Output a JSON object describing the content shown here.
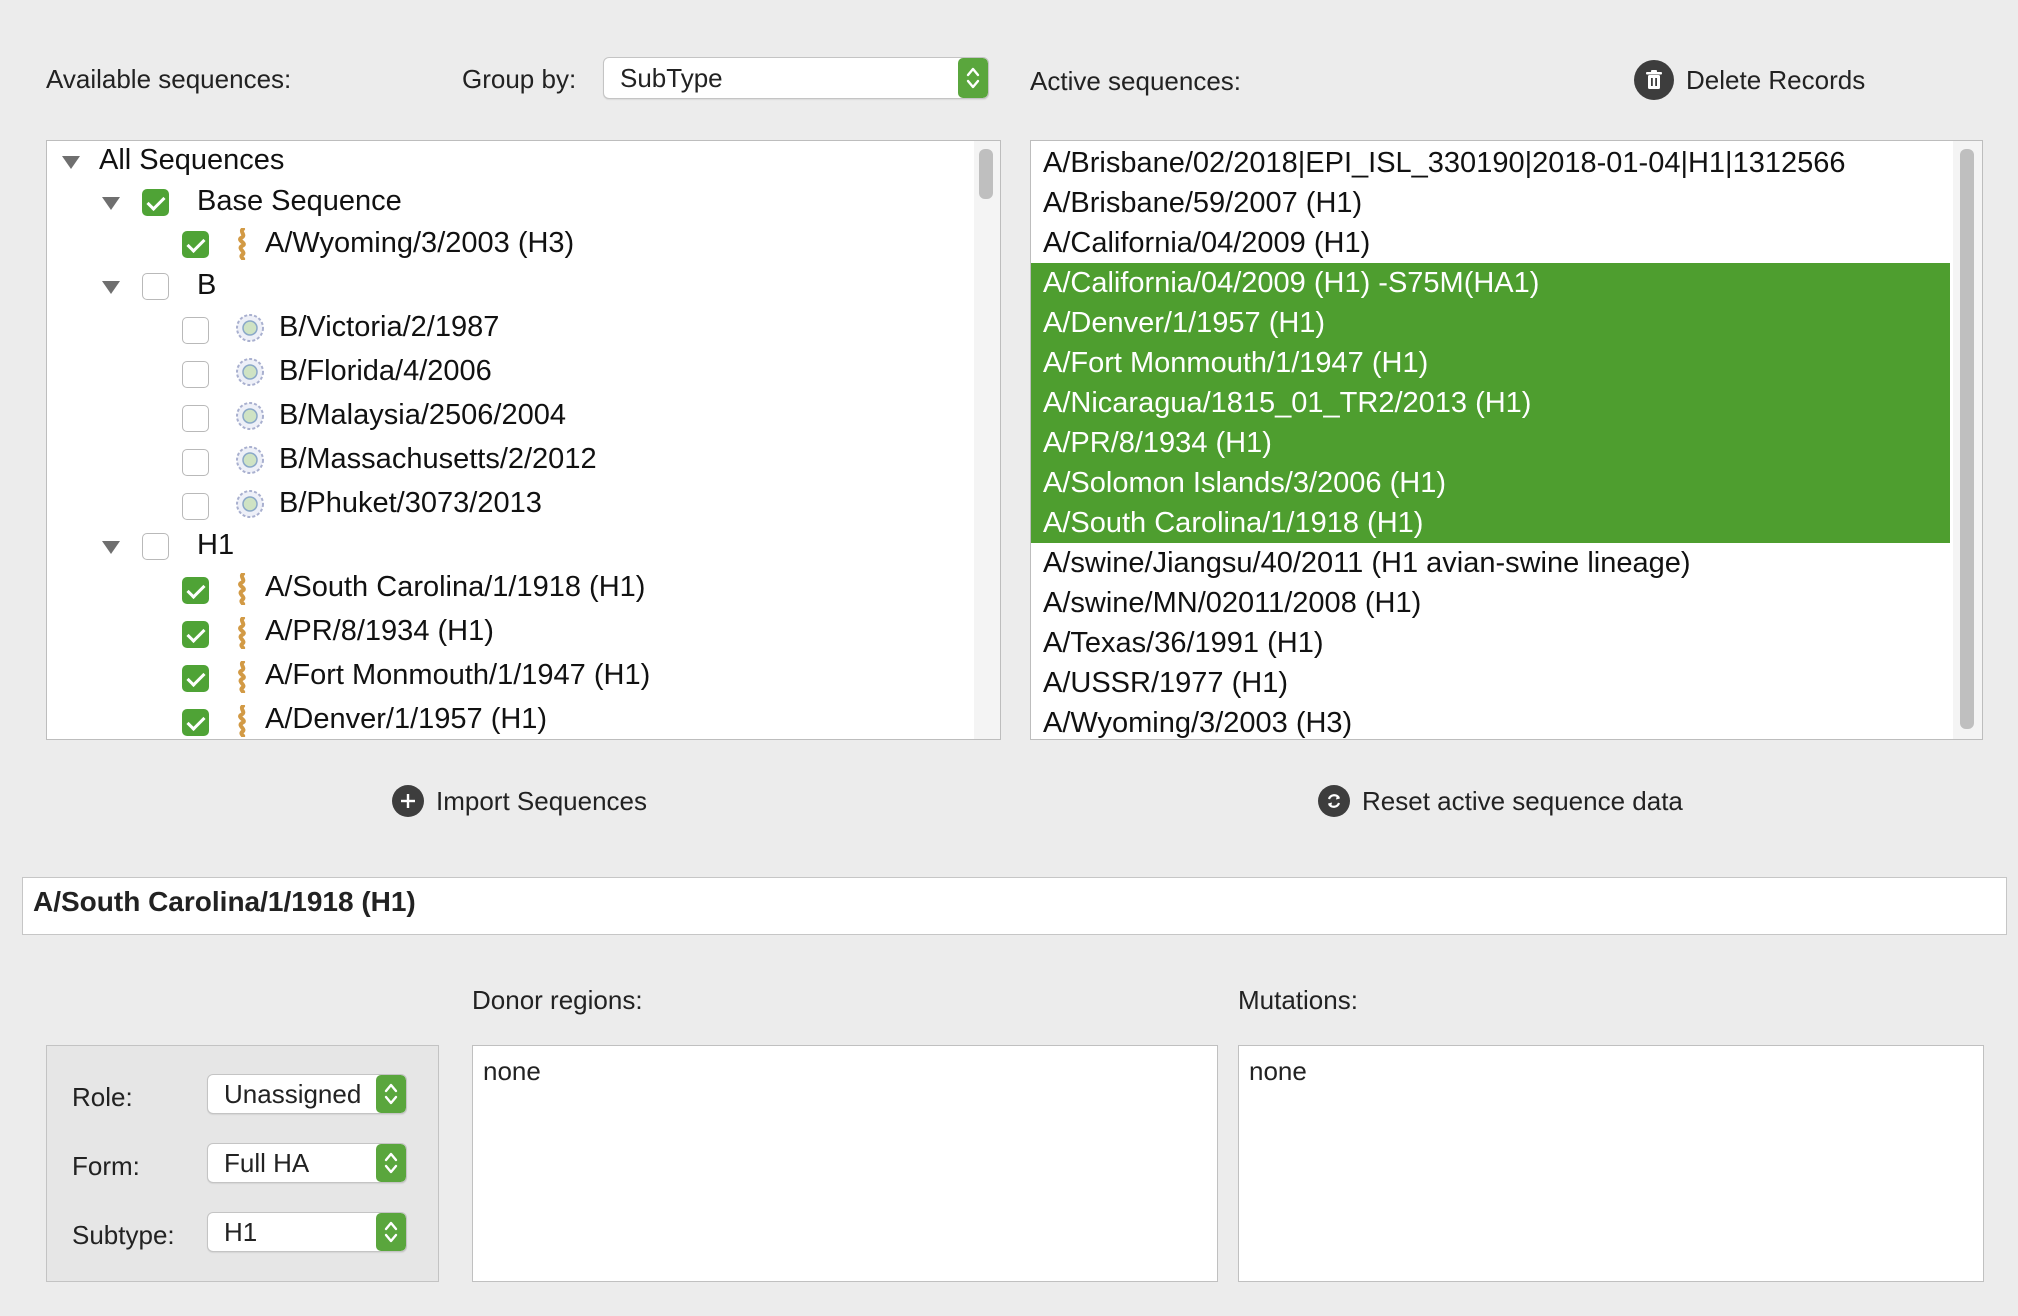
{
  "header": {
    "available_label": "Available sequences:",
    "group_by_label": "Group by:",
    "group_by_value": "SubType",
    "active_label": "Active sequences:",
    "delete_records": "Delete Records"
  },
  "tree": {
    "root": "All Sequences",
    "groups": [
      {
        "label": "Base Sequence",
        "checked": true,
        "items": [
          {
            "label": "A/Wyoming/3/2003 (H3)",
            "checked": true
          }
        ]
      },
      {
        "label": "B",
        "checked": false,
        "items": [
          {
            "label": "B/Victoria/2/1987",
            "checked": false
          },
          {
            "label": "B/Florida/4/2006",
            "checked": false
          },
          {
            "label": "B/Malaysia/2506/2004",
            "checked": false
          },
          {
            "label": "B/Massachusetts/2/2012",
            "checked": false
          },
          {
            "label": "B/Phuket/3073/2013",
            "checked": false
          }
        ]
      },
      {
        "label": "H1",
        "checked": false,
        "items": [
          {
            "label": "A/South Carolina/1/1918 (H1)",
            "checked": true
          },
          {
            "label": "A/PR/8/1934 (H1)",
            "checked": true
          },
          {
            "label": "A/Fort Monmouth/1/1947 (H1)",
            "checked": true
          },
          {
            "label": "A/Denver/1/1957 (H1)",
            "checked": true
          }
        ]
      }
    ]
  },
  "active_sequences": [
    {
      "label": "A/Brisbane/02/2018|EPI_ISL_330190|2018-01-04|H1|1312566",
      "selected": false
    },
    {
      "label": "A/Brisbane/59/2007 (H1)",
      "selected": false
    },
    {
      "label": "A/California/04/2009 (H1)",
      "selected": false
    },
    {
      "label": "A/California/04/2009 (H1) -S75M(HA1)",
      "selected": true
    },
    {
      "label": "A/Denver/1/1957 (H1)",
      "selected": true
    },
    {
      "label": "A/Fort Monmouth/1/1947 (H1)",
      "selected": true
    },
    {
      "label": "A/Nicaragua/1815_01_TR2/2013 (H1)",
      "selected": true
    },
    {
      "label": "A/PR/8/1934 (H1)",
      "selected": true
    },
    {
      "label": "A/Solomon Islands/3/2006 (H1)",
      "selected": true
    },
    {
      "label": "A/South Carolina/1/1918 (H1)",
      "selected": true
    },
    {
      "label": "A/swine/Jiangsu/40/2011 (H1 avian-swine lineage)",
      "selected": false
    },
    {
      "label": "A/swine/MN/02011/2008 (H1)",
      "selected": false
    },
    {
      "label": "A/Texas/36/1991 (H1)",
      "selected": false
    },
    {
      "label": "A/USSR/1977 (H1)",
      "selected": false
    },
    {
      "label": "A/Wyoming/3/2003 (H3)",
      "selected": false
    }
  ],
  "buttons": {
    "import": "Import Sequences",
    "reset": "Reset active sequence data"
  },
  "detail": {
    "name": "A/South Carolina/1/1918 (H1)",
    "donor_label": "Donor regions:",
    "donor_value": "none",
    "mutations_label": "Mutations:",
    "mutations_value": "none",
    "role_label": "Role:",
    "role_value": "Unassigned",
    "form_label": "Form:",
    "form_value": "Full HA",
    "subtype_label": "Subtype:",
    "subtype_value": "H1"
  },
  "colors": {
    "accent_green": "#4e9e2f",
    "checkbox_green": "#4fa336"
  }
}
